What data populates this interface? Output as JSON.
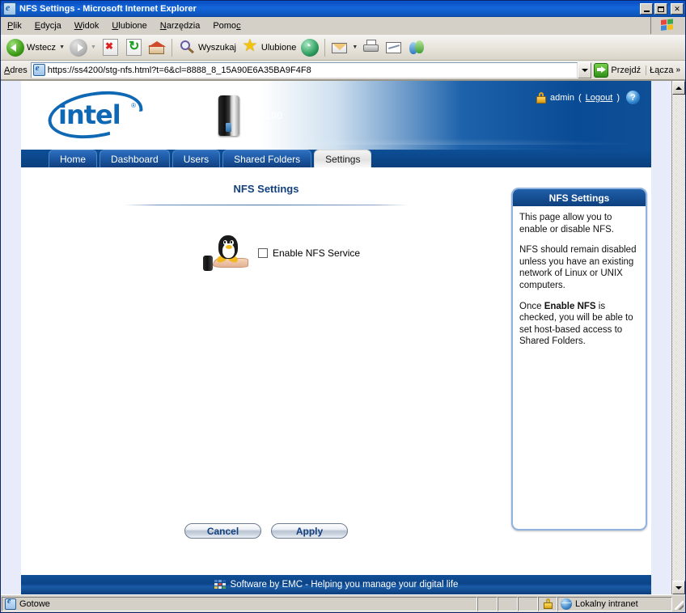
{
  "window": {
    "title": "NFS Settings - Microsoft Internet Explorer",
    "icon": "ie-document-icon",
    "minimize_label": "",
    "maximize_label": "",
    "close_label": "✕"
  },
  "menu": {
    "items": [
      {
        "label": "Plik",
        "accel": "P"
      },
      {
        "label": "Edycja",
        "accel": "E"
      },
      {
        "label": "Widok",
        "accel": "W"
      },
      {
        "label": "Ulubione",
        "accel": "U"
      },
      {
        "label": "Narzędzia",
        "accel": "N"
      },
      {
        "label": "Pomoc",
        "accel": "c"
      }
    ]
  },
  "toolbar": {
    "back_label": "Wstecz",
    "forward_label": "",
    "stop_label": "",
    "refresh_label": "",
    "home_label": "",
    "search_label": "Wyszukaj",
    "favorites_label": "Ulubione",
    "media_label": "",
    "mail_label": "",
    "print_label": "",
    "edit_label": "",
    "messenger_label": ""
  },
  "address_bar": {
    "label": "Adres",
    "url": "https://ss4200/stg-nfs.html?t=6&cl=8888_8_15A90E6A35BA9F4F8",
    "go_label": "Przejdź",
    "links_label": "Łącza",
    "links_chevron": "»"
  },
  "app": {
    "brand": "intel",
    "brand_registered": "®",
    "device_name": "ss4200",
    "user": "admin",
    "logout_label": "Logout",
    "user_paren_open": "(",
    "user_paren_close": ")",
    "help_label": "?",
    "tabs": [
      {
        "label": "Home",
        "active": false
      },
      {
        "label": "Dashboard",
        "active": false
      },
      {
        "label": "Users",
        "active": false
      },
      {
        "label": "Shared Folders",
        "active": false
      },
      {
        "label": "Settings",
        "active": true
      }
    ],
    "page_title": "NFS Settings",
    "checkbox_label": "Enable NFS Service",
    "checkbox_checked": false,
    "cancel_label": "Cancel",
    "apply_label": "Apply",
    "footer_text": "Software by EMC - Helping you manage your digital life"
  },
  "help_panel": {
    "title": "NFS Settings",
    "paragraph1": "This page allow you to enable or disable NFS.",
    "paragraph2": "NFS should remain disabled unless you have an existing network of Linux or UNIX computers.",
    "paragraph3_pre": "Once ",
    "paragraph3_bold": "Enable NFS",
    "paragraph3_post": " is checked, you will be able to set host-based access to Shared Folders."
  },
  "status_bar": {
    "text": "Gotowe",
    "zone": "Lokalny intranet"
  },
  "colors": {
    "titlebar_blue": "#0a4fc0",
    "app_header_blue": "#0a4b95",
    "intel_blue": "#0f68b4",
    "tab_active_bg": "#e2e2e2",
    "help_border": "#8fb2df",
    "page_bg": "#e7ebfa"
  }
}
